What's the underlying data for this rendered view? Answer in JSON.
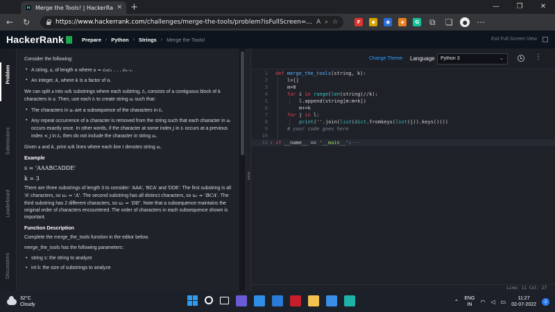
{
  "browser": {
    "tab_title": "Merge the Tools! | HackerRank",
    "url_host": "https://www.hackerrank.com",
    "url_path": "/challenges/merge-the-tools/problem?isFullScreen=...",
    "address_icons": [
      "read-aloud-icon",
      "zoom-icon",
      "favorites-icon"
    ],
    "extensions": [
      {
        "name": "fuzzy-extension",
        "label": "F",
        "color": "#e0342f"
      },
      {
        "name": "shield-extension",
        "label": "◆",
        "color": "#d9a400"
      },
      {
        "name": "rss-extension",
        "label": "◉",
        "color": "#2a6ad8"
      },
      {
        "name": "metamask-extension",
        "label": "◈",
        "color": "#e8821e"
      },
      {
        "name": "grammarly-extension",
        "label": "G",
        "color": "#15c39a"
      }
    ]
  },
  "header": {
    "logo": "HackerRank",
    "breadcrumbs": [
      "Prepare",
      "Python",
      "Strings",
      "Merge the Tools!"
    ],
    "exit_fullscreen": "Exit Full Screen View"
  },
  "sidebar": {
    "tabs": [
      "Problem",
      "Submissions",
      "Leaderboard",
      "Discussions"
    ]
  },
  "problem": {
    "p1": "Consider the following:",
    "b1_pre": "A string, ",
    "b1_s": "s",
    "b1_mid": ", of length ",
    "b1_n": "n",
    "b1_mid2": " where ",
    "b1_eq": "s = c₀c₁ . . . cₙ₋₁",
    "b1_end": ".",
    "b2_pre": "An integer, ",
    "b2_k": "k",
    "b2_mid": ", where ",
    "b2_k2": "k",
    "b2_mid2": " is a factor of ",
    "b2_n": "n",
    "b2_end": ".",
    "p2_pre": "We can split ",
    "p2_s": "s",
    "p2_mid": " into ",
    "p2_frac": "n/k",
    "p2_mid2": " substrings where each subtring, ",
    "p2_ti": "tᵢ",
    "p2_mid3": ", consists of a contiguous block of ",
    "p2_k": "k",
    "p2_mid4": " characters in ",
    "p2_s2": "s",
    "p2_mid5": ". Then, use each ",
    "p2_ti2": "tᵢ",
    "p2_mid6": " to create string ",
    "p2_ui": "uᵢ",
    "p2_end": " such that:",
    "c1_pre": "The characters in ",
    "c1_ui": "uᵢ",
    "c1_mid": " are a subsequence of the characters in ",
    "c1_ti": "tᵢ",
    "c1_end": ".",
    "c2_pre": "Any repeat occurrence of a character is removed from the string such that each character in ",
    "c2_ui": "uᵢ",
    "c2_mid": " occurs exactly once. In other words, if the character at some index ",
    "c2_j": "j",
    "c2_mid2": " in ",
    "c2_ti": "tᵢ",
    "c2_mid3": " occurs at a previous index ",
    "c2_ineq": "< j",
    "c2_mid4": " in ",
    "c2_ti2": "tᵢ",
    "c2_end": ", then do not include the character in string ",
    "c2_ui2": "uᵢ",
    "c2_dot": ".",
    "p3_pre": "Given ",
    "p3_s": "s",
    "p3_mid": " and ",
    "p3_k": "k",
    "p3_mid2": ", print ",
    "p3_frac": "n/k",
    "p3_mid3": " lines where each line ",
    "p3_i": "i",
    "p3_mid4": " denotes string ",
    "p3_ui": "uᵢ",
    "p3_end": ".",
    "example_heading": "Example",
    "ex_s": "s = 'AAABCADDE'",
    "ex_k": "k = 3",
    "e1": "There are three substrings of length 3 to consider: 'AAA', 'BCA' and 'DDE'. The first substring is all 'A' characters, so ",
    "e1_u1": "u₁ = 'A'",
    "e1_mid": ". The second substring has all distinct characters, so ",
    "e1_u2": "u₂ = 'BCA'",
    "e1_mid2": ". The third substring has 2 different characters, so ",
    "e1_u3": "u₃ = 'DE'",
    "e1_end": ". Note that a subsequence maintains the original order of characters encountered. The order of characters in each subsequence shown is important.",
    "fd_heading": "Function Description",
    "fd1": "Complete the merge_the_tools function in the editor below.",
    "fd2": "merge_the_tools has the following parameters:",
    "param1": "string s: the string to analyze",
    "param2": "int k: the size of substrings to analyze"
  },
  "editor": {
    "change_theme": "Change Theme",
    "language_label": "Language",
    "language": "Python 3",
    "line_numbers": [
      "1",
      "2",
      "3",
      "4",
      "5",
      "6",
      "7",
      "8",
      "9",
      "10",
      "11"
    ],
    "code": {
      "l1_kw": "def",
      "l1_fn": "merge_the_tools",
      "l1_rest": "(string, k):",
      "l2": "l=[]",
      "l3": "m=0",
      "l4_kw": "for",
      "l4_a": " i ",
      "l4_kw2": "in",
      "l4_sp": " ",
      "l4_bi": "range",
      "l4_b": "(",
      "l4_bi2": "len",
      "l4_c": "(string)//k):",
      "l5": "l.append(string[m:m+k])",
      "l6": "m+=k",
      "l7_kw": "for",
      "l7_a": " j ",
      "l7_kw2": "in",
      "l7_b": " l:",
      "l8_bi": "print",
      "l8_a": "(",
      "l8_st": "''",
      "l8_b": ".join(",
      "l8_bi2": "list",
      "l8_c": "(",
      "l8_bi3": "dict",
      "l8_d": ".fromkeys(",
      "l8_bi4": "list",
      "l8_e": "(j)).keys())))",
      "l9": "# your code goes here",
      "l11_kw": "if",
      "l11_a": " __name__ == ",
      "l11_st": "'__main__'",
      "l11_b": ":",
      "l11_ellipsis": "···"
    },
    "status": "Line: 11 Col: 27"
  },
  "taskbar": {
    "temperature": "32°C",
    "weather": "Cloudy",
    "lang_top": "ENG",
    "lang_bottom": "IN",
    "time": "11:27",
    "date": "02-07-2022",
    "notification_count": "2",
    "apps": [
      {
        "name": "start-icon"
      },
      {
        "name": "search-icon"
      },
      {
        "name": "task-view-icon"
      },
      {
        "name": "video-call-icon",
        "color": "#6b5bd6"
      },
      {
        "name": "learn-app-icon",
        "color": "#2f8fe8"
      },
      {
        "name": "mail-icon",
        "color": "#2a7ad8"
      },
      {
        "name": "mcafee-icon",
        "color": "#c81e2b"
      },
      {
        "name": "file-explorer-icon",
        "color": "#f2c14e"
      },
      {
        "name": "notepad-icon",
        "color": "#3a8ee6"
      },
      {
        "name": "edge-icon",
        "color": "#1db3a6"
      }
    ]
  },
  "colors": {
    "hr_green": "#1ba94c",
    "link_blue": "#2ea0ff",
    "keyword": "#e1465a",
    "function": "#60b2ff",
    "string": "#9bd46b"
  }
}
